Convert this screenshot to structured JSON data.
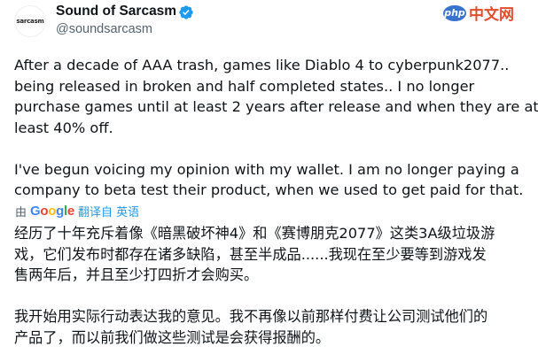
{
  "author": {
    "avatar_text": "sarcasm",
    "display_name": "Sound of Sarcasm",
    "handle": "@soundsarcasm",
    "verified_icon": "verified-badge-icon",
    "verified_color": "#1d9bf0"
  },
  "watermark": {
    "logo": "php",
    "text": "中文网"
  },
  "tweet": {
    "lines_p1": [
      "After a decade of AAA trash, games like Diablo 4 to cyberpunk2077..",
      "being released in broken and half completed states.. I no longer",
      "purchase games until at least 2 years after release and when they are at",
      "least 40% off."
    ],
    "lines_p2": [
      "I've begun voicing my opinion with my wallet. I am no longer paying a",
      "company to beta test their product, when we used to get paid for that."
    ]
  },
  "translate": {
    "by": "由",
    "provider": "Google",
    "link": "翻译自 英语"
  },
  "translation": {
    "lines_p1": [
      "经历了十年充斥着像《暗黑破坏神4》和《赛博朋克2077》这类3A级垃圾游",
      "戏，它们发布时都存在诸多缺陷，甚至半成品......我现在至少要等到游戏发",
      "售两年后，并且至少打四折才会购买。"
    ],
    "lines_p2": [
      "我开始用实际行动表达我的意见。我不再像以前那样付费让公司测试他们的",
      "产品了，而以前我们做这些测试是会获得报酬的。"
    ]
  }
}
